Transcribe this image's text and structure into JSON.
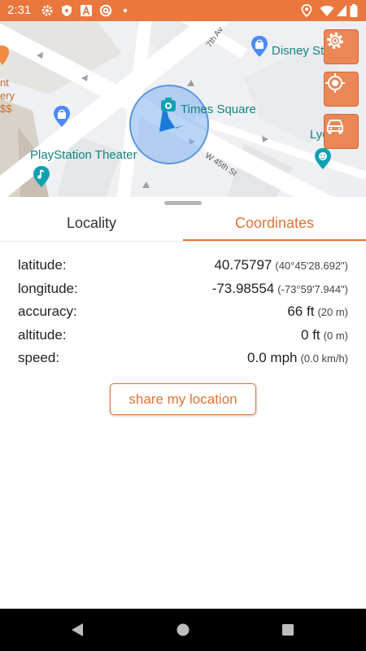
{
  "status_bar": {
    "time": "2:31",
    "left_icons": [
      "gear-icon",
      "shield-icon",
      "a-icon",
      "at-icon",
      "dot-icon"
    ],
    "right_icons": [
      "location-icon",
      "wifi-icon",
      "signal-icon",
      "battery-icon"
    ]
  },
  "map": {
    "places": [
      {
        "name": "Times Square",
        "icon": "camera-icon"
      },
      {
        "name": "Disney Sto",
        "icon": "shopping-bag-icon"
      },
      {
        "name": "PlayStation Theater",
        "icon": "music-note-icon"
      },
      {
        "name": "Lyc",
        "icon": "theater-icon"
      }
    ],
    "streets": [
      "7th Av",
      "W 45th St"
    ],
    "edge_text": [
      "nt",
      "ery",
      "$$"
    ],
    "buttons": [
      "settings-gear-icon",
      "my-location-icon",
      "car-icon"
    ]
  },
  "tabs": [
    {
      "label": "Locality",
      "selected": false
    },
    {
      "label": "Coordinates",
      "selected": true
    }
  ],
  "coordinates": [
    {
      "label": "latitude:",
      "value": "40.75797",
      "sub": "(40°45'28.692\")"
    },
    {
      "label": "longitude:",
      "value": "-73.98554",
      "sub": "(-73°59'7.944\")"
    },
    {
      "label": "accuracy:",
      "value": "66 ft",
      "sub": "(20 m)"
    },
    {
      "label": "altitude:",
      "value": "0 ft",
      "sub": "(0 m)"
    },
    {
      "label": "speed:",
      "value": "0.0 mph",
      "sub": "(0.0 km/h)"
    }
  ],
  "share_button": "share my location",
  "colors": {
    "accent": "#e07337",
    "status_bar": "#e9773e",
    "map_button": "#eb8757",
    "place_label": "#11857e"
  },
  "nav_bar": [
    "back-icon",
    "home-icon",
    "recents-icon"
  ]
}
